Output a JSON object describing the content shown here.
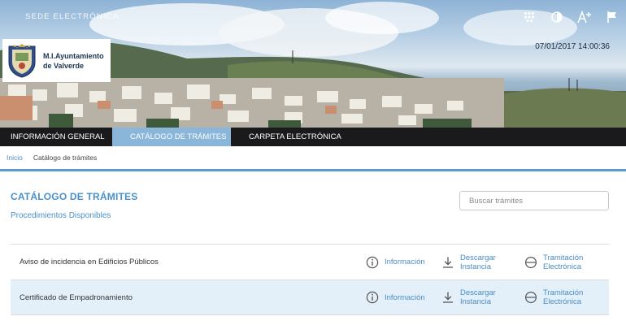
{
  "header": {
    "sede_label": "SEDE ELECTRÓNICA",
    "municipality_line1": "M.I.Ayuntamiento",
    "municipality_line2": "de Valverde",
    "datetime": "07/01/2017 14:00:36",
    "icons": [
      "apps-grid-icon",
      "contrast-icon",
      "font-size-icon",
      "flag-icon"
    ]
  },
  "nav": {
    "items": [
      {
        "label": "INFORMACIÓN GENERAL",
        "active": false
      },
      {
        "label": "CATÁLOGO DE TRÁMITES",
        "active": true
      },
      {
        "label": "CARPETA ELECTRÓNICA",
        "active": false
      }
    ]
  },
  "breadcrumb": {
    "home": "Inicio",
    "current": "Catálogo de trámites"
  },
  "main": {
    "title": "CATÁLOGO DE TRÁMITES",
    "subtitle": "Procedimientos Disponibles",
    "search_placeholder": "Buscar trámites"
  },
  "procedures": [
    {
      "name": "Aviso de incidencia en Edificios Públicos",
      "info_label": "Información",
      "download_line1": "Descargar",
      "download_line2": "Instancia",
      "process_line1": "Tramitación",
      "process_line2": "Electrónica"
    },
    {
      "name": "Certificado de Empadronamiento",
      "info_label": "Información",
      "download_line1": "Descargar",
      "download_line2": "Instancia",
      "process_line1": "Tramitación",
      "process_line2": "Electrónica"
    }
  ],
  "colors": {
    "accent": "#4a90c8",
    "nav_bg": "#1a1a1c",
    "nav_active": "#8ab6d9",
    "row_alt": "#e4f0f9"
  }
}
